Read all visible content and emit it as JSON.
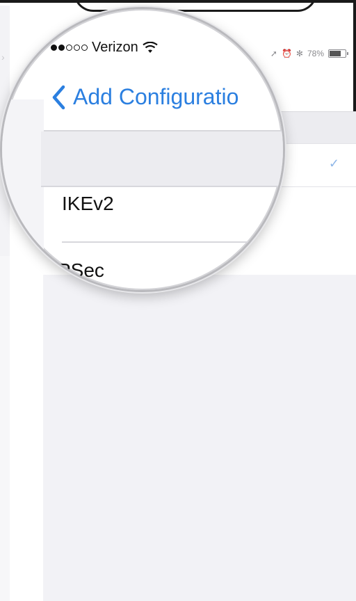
{
  "status_bar": {
    "carrier": "Verizon",
    "battery_percent": "78%",
    "battery_level": 0.78,
    "icons": [
      "signal-dots-icon",
      "wifi-icon",
      "location-arrow-icon",
      "alarm-icon",
      "bluetooth-icon",
      "battery-icon"
    ]
  },
  "nav": {
    "back_label": "Add Configuratio"
  },
  "options": [
    {
      "label": "IKEv2",
      "selected": true
    },
    {
      "label": "PSec"
    }
  ],
  "colors": {
    "accent": "#2b7fe0",
    "checkmark": "#8fb7e8",
    "grouped_background": "#f2f2f6"
  }
}
